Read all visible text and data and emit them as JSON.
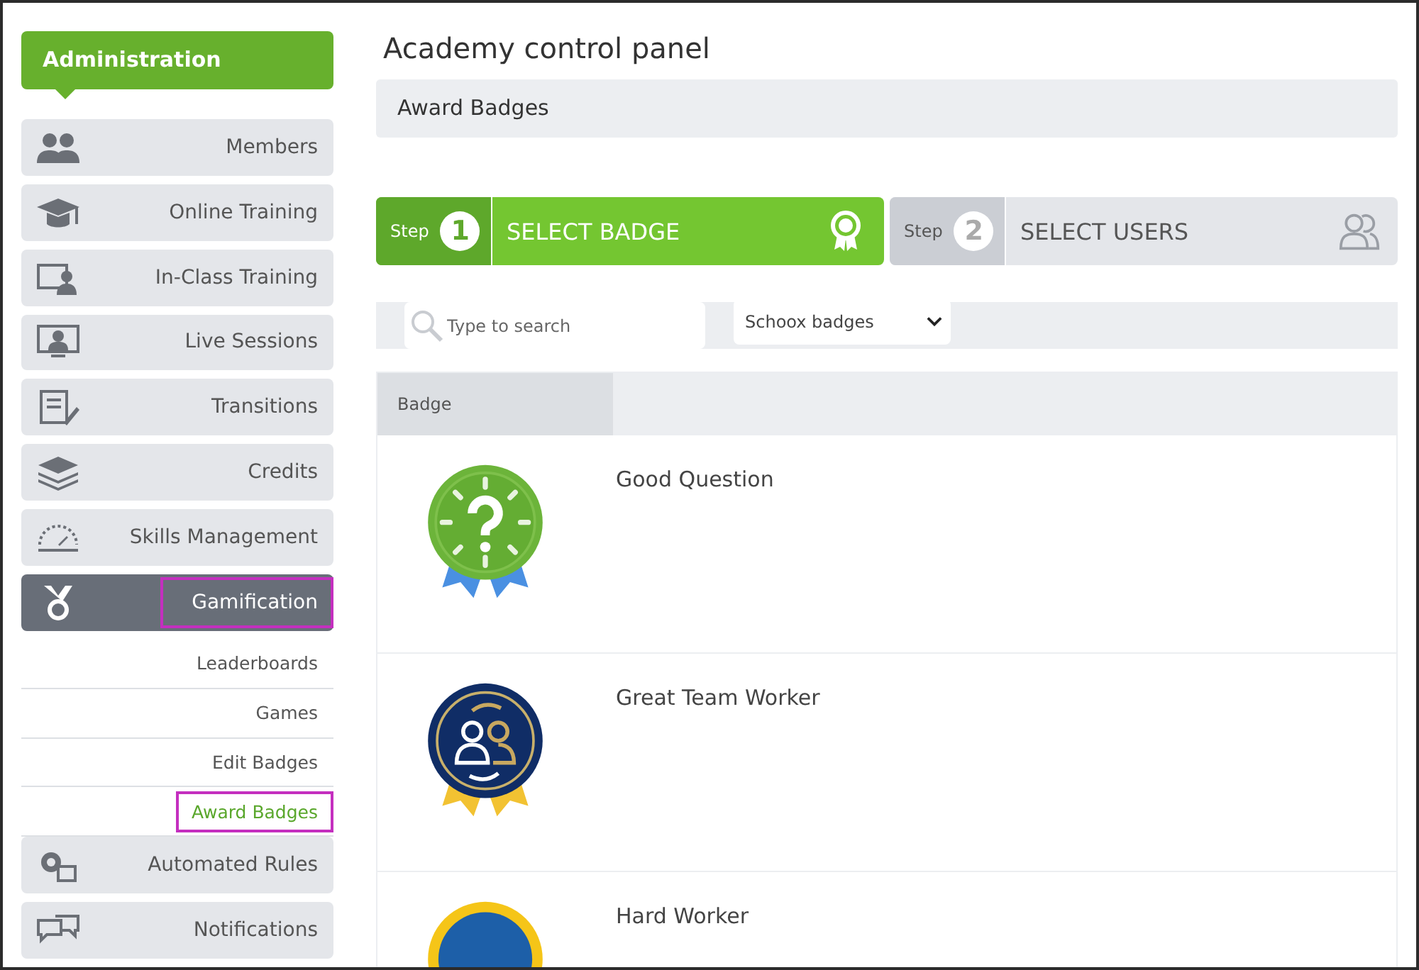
{
  "sidebar": {
    "header": "Administration",
    "items": [
      {
        "label": "Members",
        "selected": false,
        "highlighted": false
      },
      {
        "label": "Online Training",
        "selected": false,
        "highlighted": false
      },
      {
        "label": "In-Class Training",
        "selected": false,
        "highlighted": false
      },
      {
        "label": "Live Sessions",
        "selected": false,
        "highlighted": false
      },
      {
        "label": "Transitions",
        "selected": false,
        "highlighted": false
      },
      {
        "label": "Credits",
        "selected": false,
        "highlighted": false
      },
      {
        "label": "Skills Management",
        "selected": false,
        "highlighted": false
      },
      {
        "label": "Gamification",
        "selected": true,
        "highlighted": true,
        "children": [
          {
            "label": "Leaderboards",
            "selected": false,
            "highlighted": false
          },
          {
            "label": "Games",
            "selected": false,
            "highlighted": false
          },
          {
            "label": "Edit Badges",
            "selected": false,
            "highlighted": false
          },
          {
            "label": "Award Badges",
            "selected": true,
            "highlighted": true
          }
        ]
      },
      {
        "label": "Automated Rules",
        "selected": false,
        "highlighted": false
      },
      {
        "label": "Notifications",
        "selected": false,
        "highlighted": false
      }
    ]
  },
  "page": {
    "title": "Academy control panel",
    "breadcrumb": "Award Badges"
  },
  "steps": [
    {
      "step_label": "Step",
      "number": "1",
      "label": "SELECT BADGE",
      "selected": true
    },
    {
      "step_label": "Step",
      "number": "2",
      "label": "SELECT USERS",
      "selected": false
    }
  ],
  "filters": {
    "search": {
      "placeholder": "Type to search"
    },
    "dropdown": {
      "value": "Schoox badges"
    }
  },
  "table": {
    "columns": [
      "Badge"
    ],
    "rows": [
      {
        "name": "Good Question"
      },
      {
        "name": "Great Team Worker"
      },
      {
        "name": "Hard Worker"
      }
    ]
  }
}
